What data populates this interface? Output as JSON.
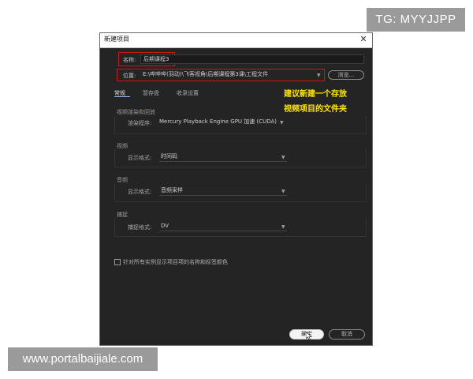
{
  "watermark_top": "TG: MYYJJPP",
  "watermark_bottom": "www.portalbaijiale.com",
  "dialog": {
    "title": "新建项目",
    "close_icon": "close-icon",
    "name_label": "名称:",
    "name_value": "后期课程3",
    "location_label": "位置:",
    "location_value": "E:\\哔哔哔(羽动)\\飞客视角\\后期课程第3课\\工程文件",
    "browse_label": "浏览...",
    "tabs": [
      "常规",
      "暂存盘",
      "收录设置"
    ],
    "active_tab": "常规",
    "annotation_line1": "建议新建一个存放",
    "annotation_line2": "视频项目的文件夹",
    "annotation_color": "#ffe600",
    "highlight_color": "#d0141a",
    "sections": {
      "render": {
        "title": "视频渲染和回放",
        "label": "渲染程序:",
        "value": "Mercury Playback Engine GPU 加速 (CUDA)"
      },
      "video": {
        "title": "视频",
        "label": "显示格式:",
        "value": "时间码"
      },
      "audio": {
        "title": "音频",
        "label": "显示格式:",
        "value": "音频采样"
      },
      "capture": {
        "title": "捕捉",
        "label": "捕捉格式:",
        "value": "DV"
      }
    },
    "checkbox_label": "针对所有实例显示项目项的名称和标签颜色",
    "checkbox_checked": false,
    "ok_label": "确定",
    "cancel_label": "取消"
  }
}
